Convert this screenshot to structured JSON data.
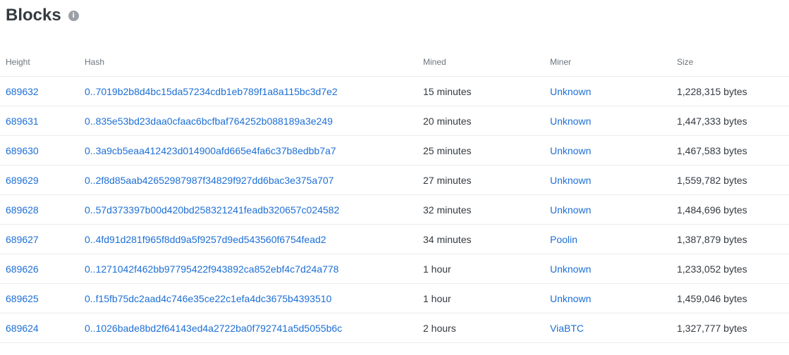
{
  "page": {
    "title": "Blocks",
    "info_icon": "info-circle-icon"
  },
  "table": {
    "columns": [
      "Height",
      "Hash",
      "Mined",
      "Miner",
      "Size"
    ],
    "rows": [
      {
        "height": "689632",
        "hash": "0..7019b2b8d4bc15da57234cdb1eb789f1a8a115bc3d7e2",
        "mined": "15 minutes",
        "miner": "Unknown",
        "size": "1,228,315 bytes"
      },
      {
        "height": "689631",
        "hash": "0..835e53bd23daa0cfaac6bcfbaf764252b088189a3e249",
        "mined": "20 minutes",
        "miner": "Unknown",
        "size": "1,447,333 bytes"
      },
      {
        "height": "689630",
        "hash": "0..3a9cb5eaa412423d014900afd665e4fa6c37b8edbb7a7",
        "mined": "25 minutes",
        "miner": "Unknown",
        "size": "1,467,583 bytes"
      },
      {
        "height": "689629",
        "hash": "0..2f8d85aab42652987987f34829f927dd6bac3e375a707",
        "mined": "27 minutes",
        "miner": "Unknown",
        "size": "1,559,782 bytes"
      },
      {
        "height": "689628",
        "hash": "0..57d373397b00d420bd258321241feadb320657c024582",
        "mined": "32 minutes",
        "miner": "Unknown",
        "size": "1,484,696 bytes"
      },
      {
        "height": "689627",
        "hash": "0..4fd91d281f965f8dd9a5f9257d9ed543560f6754fead2",
        "mined": "34 minutes",
        "miner": "Poolin",
        "size": "1,387,879 bytes"
      },
      {
        "height": "689626",
        "hash": "0..1271042f462bb97795422f943892ca852ebf4c7d24a778",
        "mined": "1 hour",
        "miner": "Unknown",
        "size": "1,233,052 bytes"
      },
      {
        "height": "689625",
        "hash": "0..f15fb75dc2aad4c746e35ce22c1efa4dc3675b4393510",
        "mined": "1 hour",
        "miner": "Unknown",
        "size": "1,459,046 bytes"
      },
      {
        "height": "689624",
        "hash": "0..1026bade8bd2f64143ed4a2722ba0f792741a5d5055b6c",
        "mined": "2 hours",
        "miner": "ViaBTC",
        "size": "1,327,777 bytes"
      }
    ]
  },
  "colors": {
    "link": "#1d6fd6",
    "header_text": "#6c757d",
    "title": "#343a40",
    "row_border": "#e9ecef"
  }
}
